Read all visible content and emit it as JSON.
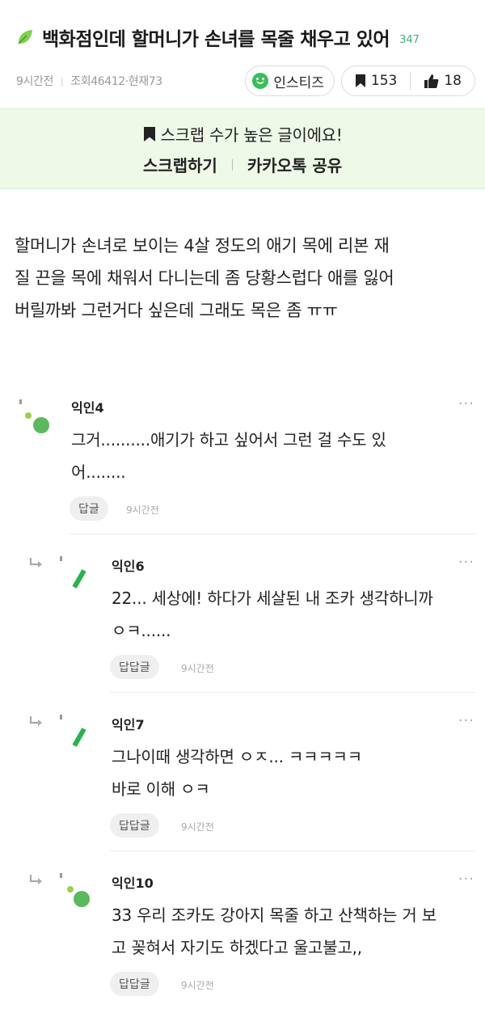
{
  "post": {
    "title": "백화점인데 할머니가 손녀를 목줄 채우고 있어",
    "title_count": "347",
    "time": "9시간전",
    "views": "조회46412·현재73",
    "category": "인스티즈",
    "scrap_count": "153",
    "like_count": "18",
    "body_lines": [
      "할머니가 손녀로 보이는 4살 정도의 애기 목에 리본 재",
      "질 끈을 목에 채워서 다니는데 좀 당황스럽다 애를 잃어",
      "버릴까봐 그런거다 싶은데 그래도 목은 좀 ㅠㅠ"
    ]
  },
  "scrap_box": {
    "message": "스크랩 수가 높은 글이에요!",
    "scrap_action": "스크랩하기",
    "share_action": "카카오톡 공유"
  },
  "comments": [
    {
      "name": "익인4",
      "lines": [
        "그거..........애기가 하고 싶어서 그런 걸 수도 있",
        "어........"
      ],
      "reply_label": "답글",
      "time": "9시간전"
    },
    {
      "name": "익인6",
      "lines": [
        "22... 세상에! 하다가 세살된 내 조카 생각하니까",
        "ㅇㅋ......"
      ],
      "reply_label": "답답글",
      "time": "9시간전"
    },
    {
      "name": "익인7",
      "lines": [
        "그나이때 생각하면 ㅇㅈ... ㅋㅋㅋㅋㅋ",
        "바로 이해 ㅇㅋ"
      ],
      "reply_label": "답답글",
      "time": "9시간전"
    },
    {
      "name": "익인10",
      "lines": [
        "33 우리 조카도 강아지 목줄 하고 산책하는 거 보",
        "고 꽂혀서 자기도 하겠다고 울고불고,,"
      ],
      "reply_label": "답답글",
      "time": "9시간전"
    }
  ],
  "more_label": "···",
  "colors": {
    "accent_green": "#3cbf5a",
    "scrap_bg": "#eef9e7"
  }
}
